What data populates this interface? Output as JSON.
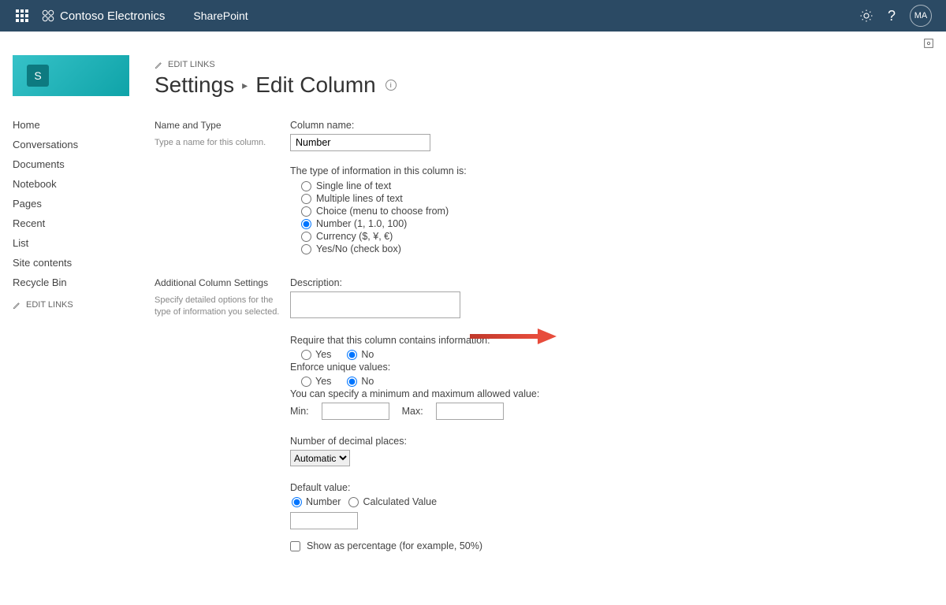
{
  "suite": {
    "brand": "Contoso Electronics",
    "product": "SharePoint",
    "avatar": "MA"
  },
  "editLinks": "EDIT LINKS",
  "siteLogoLetter": "S",
  "nav": {
    "home": "Home",
    "conversations": "Conversations",
    "documents": "Documents",
    "notebook": "Notebook",
    "pages": "Pages",
    "recent": "Recent",
    "list": "List",
    "siteContents": "Site contents",
    "recycleBin": "Recycle Bin"
  },
  "title": {
    "settings": "Settings",
    "page": "Edit Column"
  },
  "sections": {
    "nameType": {
      "heading": "Name and Type",
      "help": "Type a name for this column."
    },
    "additional": {
      "heading": "Additional Column Settings",
      "help": "Specify detailed options for the type of information you selected."
    }
  },
  "form": {
    "colNameLabel": "Column name:",
    "colNameValue": "Number",
    "typeLabel": "The type of information in this column is:",
    "typeOptions": {
      "single": "Single line of text",
      "multi": "Multiple lines of text",
      "choice": "Choice (menu to choose from)",
      "number": "Number (1, 1.0, 100)",
      "currency": "Currency ($, ¥, €)",
      "yesno": "Yes/No (check box)"
    },
    "descLabel": "Description:",
    "requireLabel": "Require that this column contains information:",
    "enforceLabel": "Enforce unique values:",
    "yes": "Yes",
    "no": "No",
    "minmaxLabel": "You can specify a minimum and maximum allowed value:",
    "minLabel": "Min:",
    "maxLabel": "Max:",
    "decLabel": "Number of decimal places:",
    "decValue": "Automatic",
    "defaultLabel": "Default value:",
    "defaultNumber": "Number",
    "defaultCalc": "Calculated Value",
    "showPct": "Show as percentage (for example, 50%)"
  }
}
